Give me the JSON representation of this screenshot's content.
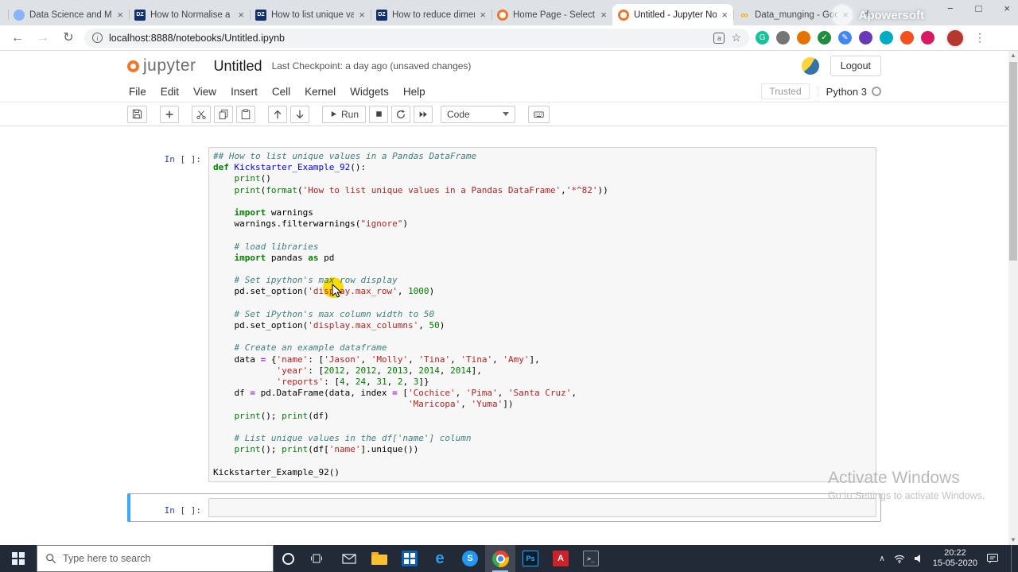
{
  "browser": {
    "tabs": [
      {
        "title": "Data Science and Mach",
        "fav": "globe",
        "active": false
      },
      {
        "title": "How to Normalise a Pa",
        "fav": "dz",
        "active": false
      },
      {
        "title": "How to list unique val",
        "fav": "dz",
        "active": false
      },
      {
        "title": "How to reduce dimen",
        "fav": "dz",
        "active": false
      },
      {
        "title": "Home Page - Select o",
        "fav": "jupyter",
        "active": false
      },
      {
        "title": "Untitled - Jupyter Not",
        "fav": "jupyter",
        "active": true
      },
      {
        "title": "Data_munging - Goog",
        "fav": "colab",
        "active": false
      }
    ],
    "address": "localhost:8888/notebooks/Untitled.ipynb",
    "extensions": [
      {
        "name": "grammarly-extension-icon",
        "color": "#15c39a",
        "glyph": "G"
      },
      {
        "name": "extension-icon",
        "color": "#757575",
        "glyph": ""
      },
      {
        "name": "extension-icon",
        "color": "#e37400",
        "glyph": ""
      },
      {
        "name": "check-extension-icon",
        "color": "#1e8e3e",
        "glyph": "✓"
      },
      {
        "name": "edit-extension-icon",
        "color": "#4285f4",
        "glyph": "✎"
      },
      {
        "name": "extension-icon",
        "color": "#673ab7",
        "glyph": ""
      },
      {
        "name": "extension-icon",
        "color": "#00acc1",
        "glyph": ""
      },
      {
        "name": "extension-icon",
        "color": "#f4511e",
        "glyph": ""
      },
      {
        "name": "camera-extension-icon",
        "color": "#d81b60",
        "glyph": ""
      }
    ]
  },
  "jupyter": {
    "logo": "jupyter",
    "title": "Untitled",
    "checkpoint": "Last Checkpoint: a day ago",
    "unsaved": "(unsaved changes)",
    "logout": "Logout",
    "menus": [
      "File",
      "Edit",
      "View",
      "Insert",
      "Cell",
      "Kernel",
      "Widgets",
      "Help"
    ],
    "trusted": "Trusted",
    "kernel_name": "Python 3",
    "run_label": "Run",
    "cell_type": "Code",
    "prompt": "In [ ]:"
  },
  "code": {
    "lines": [
      [
        [
          "c",
          "## How to list unique values in a Pandas DataFrame"
        ]
      ],
      [
        [
          "k",
          "def"
        ],
        [
          "",
          " "
        ],
        [
          "f",
          "Kickstarter_Example_92"
        ],
        [
          "",
          "():"
        ]
      ],
      [
        [
          "",
          "    "
        ],
        [
          "b",
          "print"
        ],
        [
          "",
          "()"
        ]
      ],
      [
        [
          "",
          "    "
        ],
        [
          "b",
          "print"
        ],
        [
          "",
          "("
        ],
        [
          "b",
          "format"
        ],
        [
          "",
          "("
        ],
        [
          "s",
          "'How to list unique values in a Pandas DataFrame'"
        ],
        [
          "",
          ","
        ],
        [
          "s",
          "'*^82'"
        ],
        [
          "",
          "))"
        ]
      ],
      [],
      [
        [
          "",
          "    "
        ],
        [
          "k",
          "import"
        ],
        [
          "",
          " warnings"
        ]
      ],
      [
        [
          "",
          "    warnings.filterwarnings("
        ],
        [
          "s",
          "\"ignore\""
        ],
        [
          "",
          ")"
        ]
      ],
      [],
      [
        [
          "",
          "    "
        ],
        [
          "c",
          "# load libraries"
        ]
      ],
      [
        [
          "",
          "    "
        ],
        [
          "k",
          "import"
        ],
        [
          "",
          " pandas "
        ],
        [
          "k",
          "as"
        ],
        [
          "",
          " pd"
        ]
      ],
      [],
      [
        [
          "",
          "    "
        ],
        [
          "c",
          "# Set ipython's max row display"
        ]
      ],
      [
        [
          "",
          "    pd.set_option("
        ],
        [
          "s",
          "'display.max_row'"
        ],
        [
          "",
          ", "
        ],
        [
          "n",
          "1000"
        ],
        [
          "",
          ")"
        ]
      ],
      [],
      [
        [
          "",
          "    "
        ],
        [
          "c",
          "# Set iPython's max column width to 50"
        ]
      ],
      [
        [
          "",
          "    pd.set_option("
        ],
        [
          "s",
          "'display.max_columns'"
        ],
        [
          "",
          ", "
        ],
        [
          "n",
          "50"
        ],
        [
          "",
          ")"
        ]
      ],
      [],
      [
        [
          "",
          "    "
        ],
        [
          "c",
          "# Create an example dataframe"
        ]
      ],
      [
        [
          "",
          "    data "
        ],
        [
          "o",
          "="
        ],
        [
          "",
          " {"
        ],
        [
          "s",
          "'name'"
        ],
        [
          "",
          ": ["
        ],
        [
          "s",
          "'Jason'"
        ],
        [
          "",
          ", "
        ],
        [
          "s",
          "'Molly'"
        ],
        [
          "",
          ", "
        ],
        [
          "s",
          "'Tina'"
        ],
        [
          "",
          ", "
        ],
        [
          "s",
          "'Tina'"
        ],
        [
          "",
          ", "
        ],
        [
          "s",
          "'Amy'"
        ],
        [
          "",
          "],"
        ]
      ],
      [
        [
          "",
          "            "
        ],
        [
          "s",
          "'year'"
        ],
        [
          "",
          ": ["
        ],
        [
          "n",
          "2012"
        ],
        [
          "",
          ", "
        ],
        [
          "n",
          "2012"
        ],
        [
          "",
          ", "
        ],
        [
          "n",
          "2013"
        ],
        [
          "",
          ", "
        ],
        [
          "n",
          "2014"
        ],
        [
          "",
          ", "
        ],
        [
          "n",
          "2014"
        ],
        [
          "",
          "],"
        ]
      ],
      [
        [
          "",
          "            "
        ],
        [
          "s",
          "'reports'"
        ],
        [
          "",
          ": ["
        ],
        [
          "n",
          "4"
        ],
        [
          "",
          ", "
        ],
        [
          "n",
          "24"
        ],
        [
          "",
          ", "
        ],
        [
          "n",
          "31"
        ],
        [
          "",
          ", "
        ],
        [
          "n",
          "2"
        ],
        [
          "",
          ", "
        ],
        [
          "n",
          "3"
        ],
        [
          "",
          "]}"
        ]
      ],
      [
        [
          "",
          "    df "
        ],
        [
          "o",
          "="
        ],
        [
          "",
          " pd.DataFrame(data, index "
        ],
        [
          "o",
          "="
        ],
        [
          "",
          " ["
        ],
        [
          "s",
          "'Cochice'"
        ],
        [
          "",
          ", "
        ],
        [
          "s",
          "'Pima'"
        ],
        [
          "",
          ", "
        ],
        [
          "s",
          "'Santa Cruz'"
        ],
        [
          "",
          ","
        ]
      ],
      [
        [
          "",
          "                                     "
        ],
        [
          "s",
          "'Maricopa'"
        ],
        [
          "",
          ", "
        ],
        [
          "s",
          "'Yuma'"
        ],
        [
          "",
          "])"
        ]
      ],
      [
        [
          "",
          "    "
        ],
        [
          "b",
          "print"
        ],
        [
          "",
          "(); "
        ],
        [
          "b",
          "print"
        ],
        [
          "",
          "(df)"
        ]
      ],
      [],
      [
        [
          "",
          "    "
        ],
        [
          "c",
          "# List unique values in the df['name'] column"
        ]
      ],
      [
        [
          "",
          "    "
        ],
        [
          "b",
          "print"
        ],
        [
          "",
          "(); "
        ],
        [
          "b",
          "print"
        ],
        [
          "",
          "(df["
        ],
        [
          "s",
          "'name'"
        ],
        [
          "",
          "].unique())"
        ]
      ],
      [],
      [
        [
          "",
          "Kickstarter_Example_92()"
        ]
      ]
    ]
  },
  "activate": {
    "line1": "Activate Windows",
    "line2": "Go to Settings to activate Windows."
  },
  "recorder_watermark": "Apowersoft",
  "taskbar": {
    "search_placeholder": "Type here to search",
    "time": "20:22",
    "date": "15-05-2020"
  }
}
